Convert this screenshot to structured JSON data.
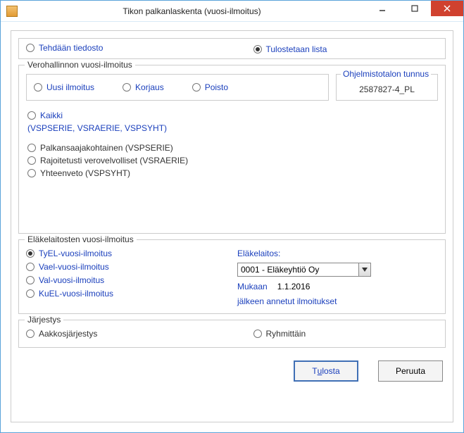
{
  "window": {
    "title": "Tikon palkanlaskenta (vuosi-ilmoitus)"
  },
  "topRadios": {
    "file": "Tehdään tiedosto",
    "print": "Tulostetaan lista"
  },
  "vero": {
    "legend": "Verohallinnon vuosi-ilmoitus",
    "types": {
      "uusi": "Uusi ilmoitus",
      "korjaus": "Korjaus",
      "poisto": "Poisto"
    },
    "ohjelmisto": {
      "legend": "Ohjelmistotalon tunnus",
      "value": "2587827-4_PL"
    },
    "kaikki": "Kaikki",
    "kaikki_sub": "(VSPSERIE, VSRAERIE, VSPSYHT)",
    "palkansaaja": "Palkansaajakohtainen (VSPSERIE)",
    "rajoitetut": "Rajoitetusti verovelvolliset (VSRAERIE)",
    "yhteenveto": "Yhteenveto (VSPSYHT)"
  },
  "elake": {
    "legend": "Eläkelaitosten vuosi-ilmoitus",
    "tyel": "TyEL-vuosi-ilmoitus",
    "vael": "Vael-vuosi-ilmoitus",
    "val": "Val-vuosi-ilmoitus",
    "kuel": "KuEL-vuosi-ilmoitus",
    "laitos_label": "Eläkelaitos:",
    "laitos_value": "0001 - Eläkeyhtiö Oy",
    "mukaan_label": "Mukaan",
    "mukaan_value": "1.1.2016",
    "mukaan_after": "jälkeen annetut ilmoitukset"
  },
  "jarjestys": {
    "legend": "Järjestys",
    "aakkos": "Aakkosjärjestys",
    "ryhm": "Ryhmittäin"
  },
  "buttons": {
    "tulosta_pre": "T",
    "tulosta_mn": "u",
    "tulosta_post": "losta",
    "peruuta": "Peruuta"
  }
}
